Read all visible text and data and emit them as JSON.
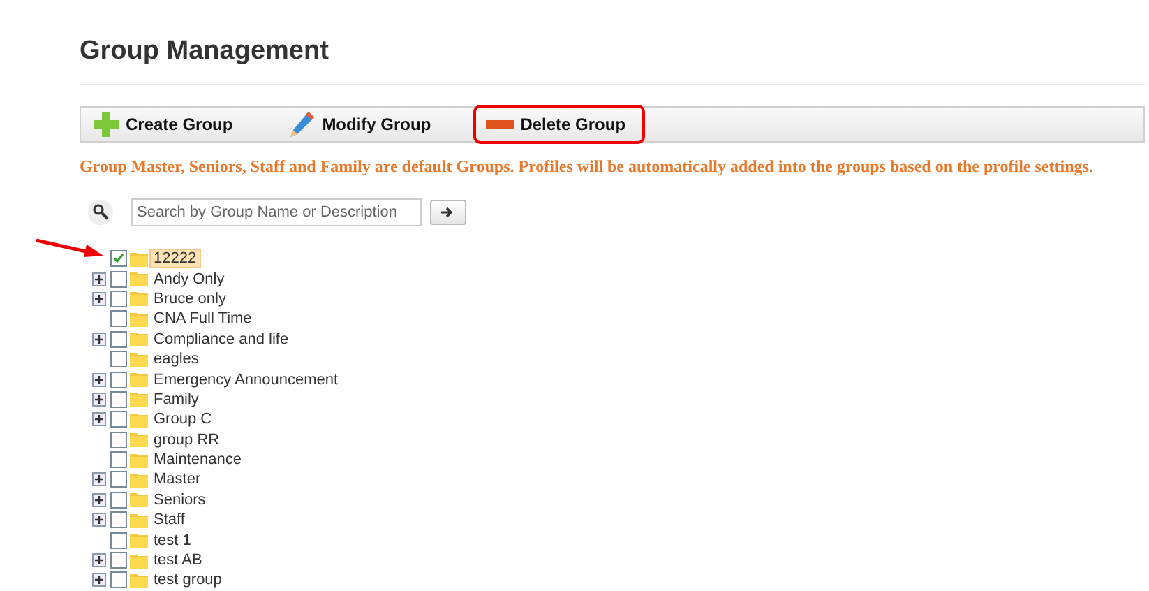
{
  "title": "Group Management",
  "toolbar": [
    {
      "kind": "create",
      "label": "Create Group",
      "highlighted": false
    },
    {
      "kind": "modify",
      "label": "Modify Group",
      "highlighted": false
    },
    {
      "kind": "delete",
      "label": "Delete Group",
      "highlighted": true
    }
  ],
  "notice": "Group Master, Seniors, Staff and Family are default Groups. Profiles will be automatically added into the groups based on the profile settings.",
  "search": {
    "placeholder": "Search by Group Name or Description"
  },
  "groups": [
    {
      "label": "12222",
      "expandable": false,
      "checked": true,
      "selected": true
    },
    {
      "label": "Andy Only",
      "expandable": true,
      "checked": false,
      "selected": false
    },
    {
      "label": "Bruce only",
      "expandable": true,
      "checked": false,
      "selected": false
    },
    {
      "label": "CNA Full Time",
      "expandable": false,
      "checked": false,
      "selected": false
    },
    {
      "label": "Compliance and life",
      "expandable": true,
      "checked": false,
      "selected": false
    },
    {
      "label": "eagles",
      "expandable": false,
      "checked": false,
      "selected": false
    },
    {
      "label": "Emergency Announcement",
      "expandable": true,
      "checked": false,
      "selected": false
    },
    {
      "label": "Family",
      "expandable": true,
      "checked": false,
      "selected": false
    },
    {
      "label": "Group C",
      "expandable": true,
      "checked": false,
      "selected": false
    },
    {
      "label": "group RR",
      "expandable": false,
      "checked": false,
      "selected": false
    },
    {
      "label": "Maintenance",
      "expandable": false,
      "checked": false,
      "selected": false
    },
    {
      "label": "Master",
      "expandable": true,
      "checked": false,
      "selected": false
    },
    {
      "label": "Seniors",
      "expandable": true,
      "checked": false,
      "selected": false
    },
    {
      "label": "Staff",
      "expandable": true,
      "checked": false,
      "selected": false
    },
    {
      "label": "test 1",
      "expandable": false,
      "checked": false,
      "selected": false
    },
    {
      "label": "test AB",
      "expandable": true,
      "checked": false,
      "selected": false
    },
    {
      "label": "test group",
      "expandable": true,
      "checked": false,
      "selected": false
    }
  ]
}
